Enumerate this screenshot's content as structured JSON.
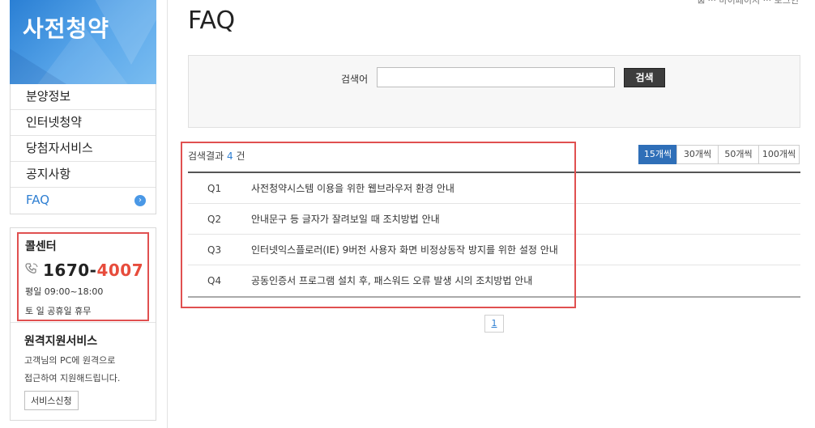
{
  "top_right": "⊠ ··· 마이페이지 ··· 로그인",
  "sidebar": {
    "banner_title": "사전청약",
    "menu": [
      {
        "label": "분양정보"
      },
      {
        "label": "인터넷청약"
      },
      {
        "label": "당첨자서비스"
      },
      {
        "label": "공지사항"
      },
      {
        "label": "FAQ"
      }
    ],
    "active_arrow": "›",
    "callcenter": {
      "title": "콜센터",
      "phone_prefix": "1670-",
      "phone_suffix": "4007",
      "hours": "평일 09:00~18:00",
      "holiday": "토 일 공휴일 휴무"
    },
    "remote": {
      "title": "원격지원서비스",
      "desc1": "고객님의 PC에 원격으로",
      "desc2": "접근하여 지원해드립니다.",
      "button": "서비스신청"
    }
  },
  "main": {
    "title": "FAQ",
    "search": {
      "label": "검색어",
      "value": "",
      "button": "검색"
    },
    "result": {
      "prefix": "검색결과 ",
      "count": "4",
      "suffix": " 건"
    },
    "perpage": [
      "15개씩",
      "30개씩",
      "50개씩",
      "100개씩"
    ],
    "perpage_selected": "15개씩",
    "faq": [
      {
        "q": "Q1",
        "title": "사전청약시스템 이용을 위한 웹브라우저 환경 안내"
      },
      {
        "q": "Q2",
        "title": "안내문구 등 글자가 잘려보일 때 조치방법 안내"
      },
      {
        "q": "Q3",
        "title": "인터넷익스플로러(IE) 9버전 사용자 화면 비정상동작 방지를 위한 설정 안내"
      },
      {
        "q": "Q4",
        "title": "공동인증서 프로그램 설치 후, 패스워드 오류 발생 시의 조치방법 안내"
      }
    ],
    "page": "1"
  },
  "colors": {
    "accent": "#2f7fd2",
    "highlight_box": "#e05050",
    "phone_red": "#e74c3c"
  }
}
